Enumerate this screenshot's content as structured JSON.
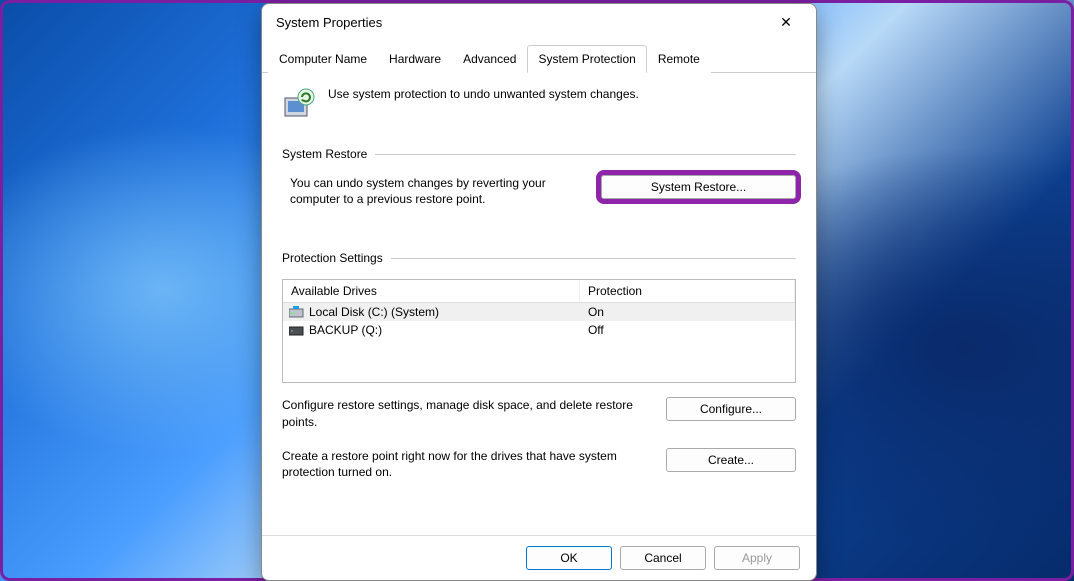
{
  "window": {
    "title": "System Properties"
  },
  "tabs": [
    {
      "label": "Computer Name"
    },
    {
      "label": "Hardware"
    },
    {
      "label": "Advanced"
    },
    {
      "label": "System Protection"
    },
    {
      "label": "Remote"
    }
  ],
  "intro": {
    "text": "Use system protection to undo unwanted system changes."
  },
  "section_restore": {
    "title": "System Restore",
    "desc": "You can undo system changes by reverting your computer to a previous restore point.",
    "button": "System Restore..."
  },
  "section_protection": {
    "title": "Protection Settings",
    "columns": {
      "drive": "Available Drives",
      "protection": "Protection"
    },
    "rows": [
      {
        "icon": "disk-system-icon",
        "name": "Local Disk (C:) (System)",
        "protection": "On"
      },
      {
        "icon": "disk-icon",
        "name": "BACKUP (Q:)",
        "protection": "Off"
      }
    ],
    "configure_desc": "Configure restore settings, manage disk space, and delete restore points.",
    "configure_btn": "Configure...",
    "create_desc": "Create a restore point right now for the drives that have system protection turned on.",
    "create_btn": "Create..."
  },
  "footer": {
    "ok": "OK",
    "cancel": "Cancel",
    "apply": "Apply"
  }
}
